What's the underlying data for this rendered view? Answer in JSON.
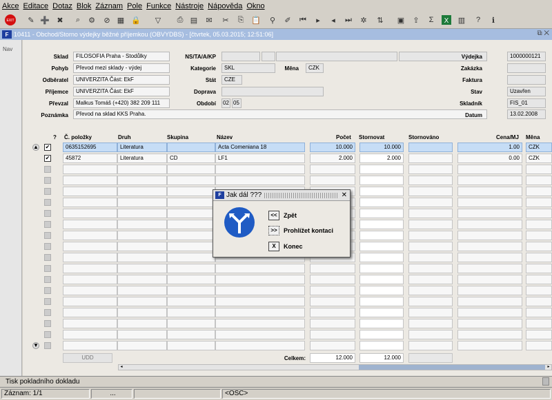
{
  "menu": [
    "Akce",
    "Editace",
    "Dotaz",
    "Blok",
    "Záznam",
    "Pole",
    "Funkce",
    "Nástroje",
    "Nápověda",
    "Okno"
  ],
  "window": {
    "title": "10411 - Obchod/Storno výdejky běžné příjemkou (OBVYDBS) - [čtvrtek, 05.03.2015; 12:51:06]",
    "logo": "F",
    "controls": "⧉ ✕"
  },
  "nav": {
    "label": "Nav"
  },
  "header": {
    "sklad_label": "Sklad",
    "sklad": "FILOSOFIA Praha - Stodůlky",
    "pohyb_label": "Pohyb",
    "pohyb": "Převod mezi sklady - výdej",
    "odberatel_label": "Odběratel",
    "odberatel": "UNIVERZITA Část: EkF",
    "prijemce_label": "Příjemce",
    "prijemce": "UNIVERZITA Část: EkF",
    "prevzal_label": "Převzal",
    "prevzal": "Malkus Tomáš (+420) 382 209 111",
    "poznamka_label": "Poznámka",
    "poznamka": "Převod na sklad KKS Praha.",
    "ns_label": "NS/TA/A/KP",
    "kategorie_label": "Kategorie",
    "kategorie": "SKL",
    "mena_label": "Měna",
    "mena": "CZK",
    "stat_label": "Stát",
    "stat": "CZE",
    "doprava_label": "Doprava",
    "obdobi_label": "Období",
    "obdobi_1": "02",
    "obdobi_2": "05",
    "vydejka_label": "Výdejka",
    "vydejka": "1000000121",
    "zakazka_label": "Zakázka",
    "faktura_label": "Faktura",
    "stav_label": "Stav",
    "stav": "Uzavřen",
    "skladnik_label": "Skladník",
    "skladnik": "FIS_01",
    "datum_label": "Datum",
    "datum": "13.02.2008"
  },
  "table": {
    "columns": {
      "q": "?",
      "cislo": "Č. položky",
      "druh": "Druh",
      "skupina": "Skupina",
      "nazev": "Název",
      "pocet": "Počet",
      "stornovat": "Stornovat",
      "stornovano": "Stornováno",
      "cena": "Cena/MJ",
      "mena": "Měna"
    },
    "rows": [
      {
        "checked": true,
        "cislo": "0635152695",
        "druh": "Literatura",
        "skupina": "",
        "nazev": "Acta Comeniana 18",
        "pocet": "10.000",
        "stornovat": "10.000",
        "stornovano": "",
        "cena": "1.00",
        "mena": "CZK"
      },
      {
        "checked": true,
        "cislo": "45872",
        "druh": "Literatura",
        "skupina": "CD",
        "nazev": "LF1",
        "pocet": "2.000",
        "stornovat": "2.000",
        "stornovano": "",
        "cena": "0.00",
        "mena": "CZK"
      }
    ],
    "udd_button": "UDD",
    "total_label": "Celkem:",
    "total_pocet": "12.000",
    "total_stornovat": "12.000"
  },
  "dialog": {
    "title": "Jak dál ???",
    "close": "✕",
    "zpet_btn": "<<",
    "zpet_label": "Zpět",
    "prohlizet_btn": ">>",
    "prohlizet_label": "Prohlížet kontaci",
    "konec_btn": "X",
    "konec_label": "Konec"
  },
  "status": {
    "message": "Tisk pokladního dokladu",
    "record": "Záznam: 1/1",
    "seg2": "...",
    "osc": "<OSC>"
  }
}
